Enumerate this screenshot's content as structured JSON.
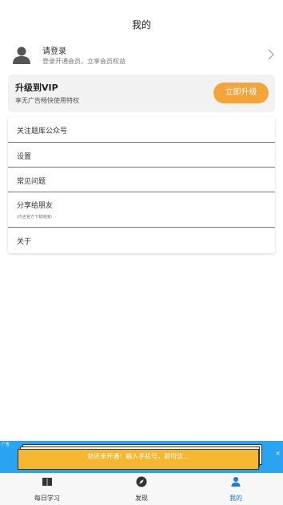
{
  "header": {
    "title": "我的"
  },
  "profile": {
    "avatar_icon": "user-avatar-icon",
    "name": "请登录",
    "subtitle": "登录开通会员，立享会员权益",
    "chevron_icon": "chevron-right-icon"
  },
  "vip": {
    "title": "升级到VIP",
    "subtitle": "享无广告畅快使用特权",
    "button_label": "立即升级",
    "button_color": "#f5a43a"
  },
  "menu": {
    "items": [
      {
        "label": "关注题库公众号",
        "note": ""
      },
      {
        "label": "设置",
        "note": ""
      },
      {
        "label": "常见问题",
        "note": ""
      },
      {
        "label": "分享给朋友",
        "note": "(内含官方下载链接)"
      },
      {
        "label": "关于",
        "note": ""
      }
    ]
  },
  "ad": {
    "tag": "广告",
    "text": "您还未开通！输入手机号，即可优...",
    "close_icon": "close-icon",
    "background": "#2aa3f0"
  },
  "tabbar": {
    "active_color": "#1a7be0",
    "tabs": [
      {
        "label": "每日学习",
        "icon": "book-icon",
        "active": false
      },
      {
        "label": "发现",
        "icon": "compass-icon",
        "active": false
      },
      {
        "label": "我的",
        "icon": "person-icon",
        "active": true
      }
    ]
  }
}
